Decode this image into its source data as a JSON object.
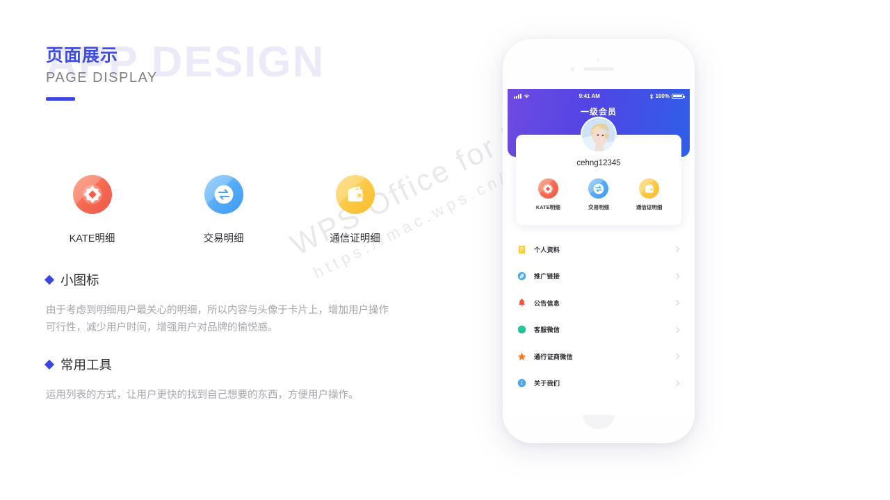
{
  "watermark": {
    "big_text": "APP DESIGN",
    "diag_line1": "WPS Office for Mac",
    "diag_line2": "https://mac.wps.cn/"
  },
  "header": {
    "title_cn": "页面展示",
    "title_en": "PAGE  DISPLAY",
    "accent_color": "#3b45e0"
  },
  "icons": [
    {
      "name": "KATE明细",
      "icon": "kate-diamond-icon",
      "color": "#f4674f"
    },
    {
      "name": "交易明细",
      "icon": "exchange-arrows-icon",
      "color": "#53a9f6"
    },
    {
      "name": "通信证明细",
      "icon": "wallet-icon",
      "color": "#fbc63f"
    }
  ],
  "sections": [
    {
      "title": "小图标",
      "body": "由于考虑到明细用户最关心的明细，所以内容与头像于卡片上，增加用户操作可行性，减少用户时间，增强用户对品牌的愉悦感。"
    },
    {
      "title": "常用工具",
      "body": "运用列表的方式，让用户更快的找到自己想要的东西，方便用户操作。"
    }
  ],
  "phone": {
    "statusbar": {
      "time": "9:41 AM",
      "battery_percent": "100%",
      "signal_icon": "signal-bars-icon",
      "wifi_icon": "wifi-icon",
      "bluetooth_icon": "bluetooth-icon",
      "battery_icon": "battery-full-icon"
    },
    "nav_title": "一级会员",
    "header_gradient_from": "#6f4ae2",
    "header_gradient_to": "#2f5fe9",
    "card": {
      "avatar_name": "user-avatar",
      "username": "cehng12345",
      "shortcuts": [
        {
          "name": "KATE明细",
          "icon": "kate-diamond-icon"
        },
        {
          "name": "交易明细",
          "icon": "exchange-arrows-icon"
        },
        {
          "name": "通信证明细",
          "icon": "wallet-icon"
        }
      ]
    },
    "menu": [
      {
        "label": "个人资料",
        "icon": "document-icon",
        "color": "#ffc93c"
      },
      {
        "label": "推广链接",
        "icon": "link-icon",
        "color": "#4aa8f0"
      },
      {
        "label": "公告信息",
        "icon": "bell-icon",
        "color": "#f4533f"
      },
      {
        "label": "客服微信",
        "icon": "chat-circle-icon",
        "color": "#22c99b"
      },
      {
        "label": "通行证商微信",
        "icon": "star-icon",
        "color": "#f97a20"
      },
      {
        "label": "关于我们",
        "icon": "info-circle-icon",
        "color": "#4aa8f0"
      }
    ]
  }
}
